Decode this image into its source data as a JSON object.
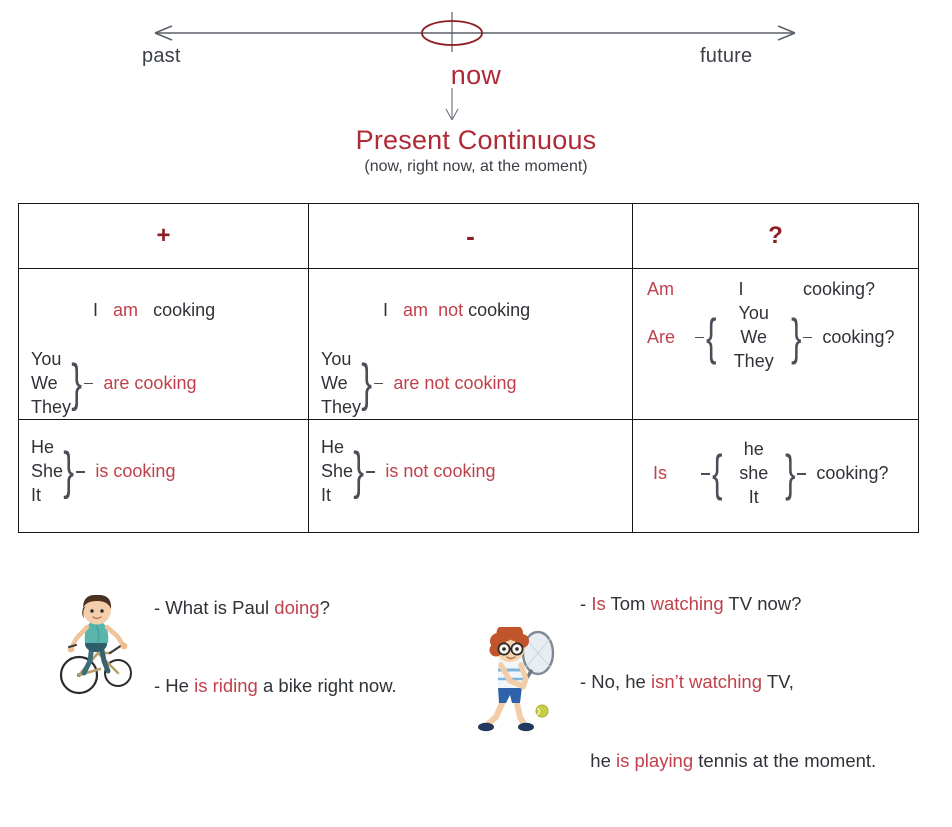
{
  "timeline": {
    "past_label": "past",
    "future_label": "future",
    "now_label": "now",
    "now_marker_icon": "ellipse-marker-icon",
    "left_arrow_icon": "arrow-left-icon",
    "right_arrow_icon": "arrow-right-icon",
    "down_arrow_icon": "arrow-down-icon"
  },
  "title": {
    "main": "Present Continuous",
    "subtitle": "(now, right now, at the moment)"
  },
  "colors": {
    "accent_red": "#c0414b",
    "title_red": "#b02a37",
    "header_red": "#8f1d26",
    "dark_text": "#2f3338",
    "border": "#161616"
  },
  "table": {
    "headers": {
      "positive": "+",
      "negative": "-",
      "question": "?"
    },
    "rows": [
      {
        "positive": {
          "simple": {
            "subject": "I",
            "aux": "am",
            "verb": "cooking"
          },
          "group": {
            "pronouns": [
              "You",
              "We",
              "They"
            ],
            "verb": "are cooking"
          }
        },
        "negative": {
          "simple": {
            "subject": "I",
            "aux": "am",
            "neg": "not",
            "verb": "cooking"
          },
          "group": {
            "pronouns": [
              "You",
              "We",
              "They"
            ],
            "verb": "are not cooking"
          }
        },
        "question": {
          "simple": {
            "aux": "Am",
            "subject": "I",
            "verb": "cooking?"
          },
          "group": {
            "aux": "Are",
            "pronouns": [
              "You",
              "We",
              "They"
            ],
            "verb": "cooking?"
          }
        }
      },
      {
        "positive": {
          "group": {
            "pronouns": [
              "He",
              "She",
              "It"
            ],
            "verb": "is cooking"
          }
        },
        "negative": {
          "group": {
            "pronouns": [
              "He",
              "She",
              "It"
            ],
            "verb": "is not cooking"
          }
        },
        "question": {
          "group": {
            "aux": "Is",
            "pronouns": [
              "he",
              "she",
              "It"
            ],
            "verb": "cooking?"
          }
        }
      }
    ]
  },
  "examples": {
    "left": {
      "illustration": "boy-riding-bicycle-illustration",
      "line1_q": "- What is Paul ",
      "line1_hl": "doing",
      "line1_end": "?",
      "line2_a": "- He ",
      "line2_hl": "is riding",
      "line2_end": " a bike right now."
    },
    "right": {
      "illustration": "boy-playing-tennis-illustration",
      "line1_a": "- ",
      "line1_hl1": "Is",
      "line1_mid": " Tom ",
      "line1_hl2": "watching",
      "line1_end": " TV now?",
      "line2_a": "- No, he ",
      "line2_hl": "isn’t watching",
      "line2_end": " TV,",
      "line3_a": "  he ",
      "line3_hl": "is playing",
      "line3_end": " tennis at the moment."
    }
  }
}
